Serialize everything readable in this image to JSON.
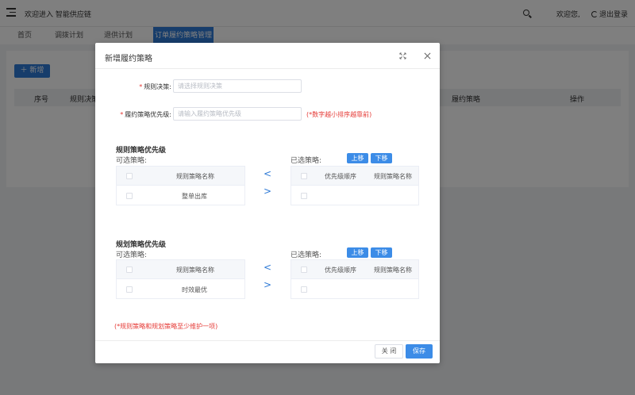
{
  "app": {
    "title": "欢迎进入 智能供应链",
    "welcome": "欢迎您,",
    "logout": "退出登录"
  },
  "tabs": [
    {
      "label": "首页"
    },
    {
      "label": "调拨计划"
    },
    {
      "label": "退供计划"
    },
    {
      "label": "订单履约策略管理"
    }
  ],
  "toolbar": {
    "add_label": "新增"
  },
  "table": {
    "headers": [
      "序号",
      "规则决策",
      "履约策略",
      "操作"
    ]
  },
  "modal": {
    "title": "新增履约策略",
    "rule_decision": {
      "label": "规则决策:",
      "placeholder": "请选择规则决策",
      "value": ""
    },
    "priority": {
      "label": "履约策略优先级:",
      "placeholder": "请输入履约策略优先级",
      "value": "",
      "hint": "(*数字越小排序越靠前)"
    },
    "rule_section": {
      "title": "规则策略优先级",
      "available_label": "可选策略:",
      "selected_label": "已选策略:",
      "move_up": "上移",
      "move_down": "下移",
      "available_header": "规则策略名称",
      "available_rows": [
        "整单出库"
      ],
      "selected_headers": [
        "优先级顺序",
        "规则策略名称"
      ],
      "selected_rows": []
    },
    "plan_section": {
      "title": "规划策略优先级",
      "available_label": "可选策略:",
      "selected_label": "已选策略:",
      "move_up": "上移",
      "move_down": "下移",
      "available_header": "规则策略名称",
      "available_rows": [
        "时效最优"
      ],
      "selected_headers": [
        "优先级顺序",
        "规则策略名称"
      ],
      "selected_rows": []
    },
    "arrows": {
      "left": "<",
      "right": ">"
    },
    "footer_hint": "(*规则策略和规划策略至少维护一项)",
    "close_label": "关 闭",
    "save_label": "保存"
  },
  "colors": {
    "primary": "#2f7ad6",
    "button": "#3c8ce7",
    "required": "#e53935"
  }
}
